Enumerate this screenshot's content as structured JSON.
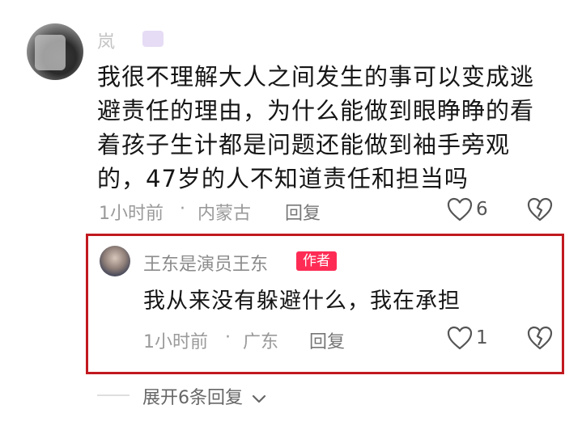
{
  "comment": {
    "username": "岚",
    "lines": [
      "我很不理解大人之间发生的事可以变成逃",
      "避责任的理由，为什么能做到眼睁睁的看",
      "着孩子生计都是问题还能做到袖手旁观",
      "的，47岁的人不知道责任和担当吗"
    ],
    "time": "1小时前",
    "separator": "·",
    "location": "内蒙古",
    "reply_label": "回复",
    "likes": "6"
  },
  "reply": {
    "username": "王东是演员王东",
    "badge": "作者",
    "text": "我从来没有躲避什么，我在承担",
    "time": "1小时前",
    "separator": "·",
    "location": "广东",
    "reply_label": "回复",
    "likes": "1"
  },
  "expand": {
    "label": "展开6条回复"
  },
  "colors": {
    "highlight_border": "#c1191f",
    "author_badge": "#fe2c55"
  }
}
